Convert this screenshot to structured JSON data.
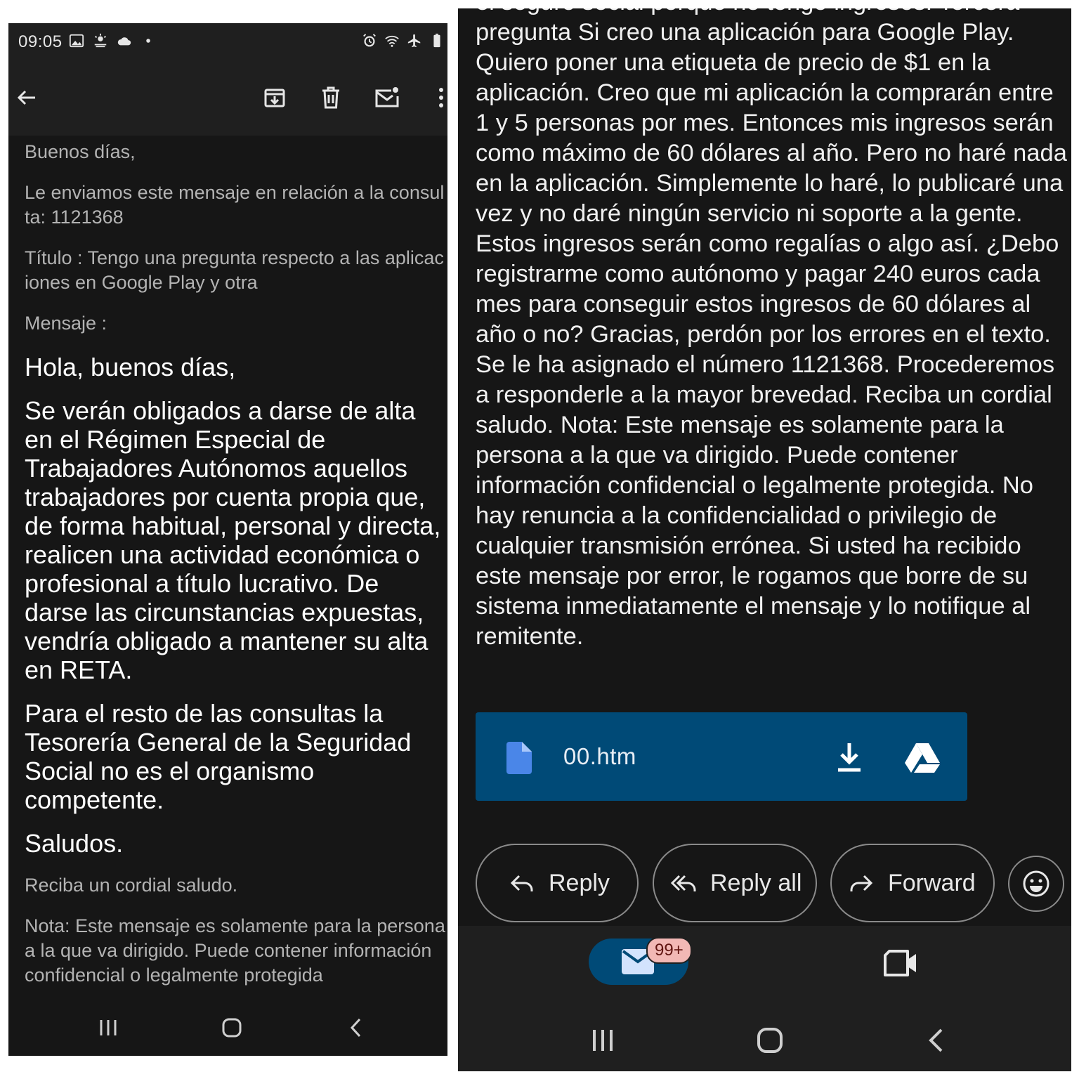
{
  "colors": {
    "background": "#161616",
    "toolbar": "#1f1f1f",
    "attachment": "#004a77",
    "badge": "#f2b8b5"
  },
  "left": {
    "status_bar": {
      "time": "09:05",
      "icons_left": [
        "image-icon",
        "weather-icon",
        "cloud-icon",
        "dot-icon"
      ],
      "icons_right": [
        "alarm-icon",
        "wifi-icon",
        "airplane-icon",
        "battery-icon"
      ]
    },
    "toolbar": {
      "icons": [
        "back-arrow-icon",
        "archive-icon",
        "delete-icon",
        "mark-unread-icon",
        "more-vert-icon"
      ]
    },
    "email": {
      "greeting": "Buenos días,",
      "intro": "Le enviamos este mensaje en relación a la consulta: 1121368",
      "title_line": "Título : Tengo una pregunta respecto a las aplicaciones en Google Play y otra",
      "message_label": "Mensaje :",
      "hello": "Hola, buenos días,",
      "paragraph1": "Se verán obligados a darse de alta en el Régimen Especial de Trabajadores Autónomos aquellos trabajadores por cuenta propia que, de forma habitual, personal y directa, realicen una actividad económica o profesional a título lucrativo. De darse las circunstancias expuestas, vendría obligado a mantener su alta en RETA.",
      "paragraph2": "Para el resto de las consultas la Tesorería General de la Seguridad Social no es el organismo competente.",
      "sign": "Saludos.",
      "closing": "Reciba un cordial saludo.",
      "note": "Nota: Este mensaje es solamente para la persona a la que va dirigido. Puede contener información confidencial o legalmente protegida"
    },
    "nav": [
      "recents-icon",
      "home-icon",
      "back-icon"
    ]
  },
  "right": {
    "body_text": "el seguro social porque no tengo ingresos. Tercera pregunta Si creo una aplicación para Google Play. Quiero poner una etiqueta de precio de $1 en la aplicación. Creo que mi aplicación la comprarán entre 1 y 5 personas por mes. Entonces mis ingresos serán como máximo de 60 dólares al año. Pero no haré nada en la aplicación. Simplemente lo haré, lo publicaré una vez y no daré ningún servicio ni soporte a la gente. Estos ingresos serán como regalías o algo así. ¿Debo registrarme como autónomo y pagar 240 euros cada mes para conseguir estos ingresos de 60 dólares al año o no? Gracias, perdón por los errores en el texto. Se le ha asignado el número 1121368. Procederemos a responderle a la mayor brevedad. Reciba un cordial saludo. Nota: Este mensaje es solamente para la persona a la que va dirigido. Puede contener información confidencial o legalmente protegida. No hay renuncia a la confidencialidad o privilegio de cualquier transmisión errónea. Si usted ha recibido este mensaje por error, le rogamos que borre de su sistema inmediatamente el mensaje y lo notifique al remitente.",
    "attachment": {
      "filename": "00.htm",
      "icons": [
        "file-icon",
        "download-icon",
        "drive-icon"
      ]
    },
    "actions": {
      "reply": "Reply",
      "reply_all": "Reply all",
      "forward": "Forward"
    },
    "bottom": {
      "badge": "99+",
      "icons": [
        "mail-icon",
        "video-icon"
      ]
    },
    "nav": [
      "recents-icon",
      "home-icon",
      "back-icon"
    ]
  }
}
